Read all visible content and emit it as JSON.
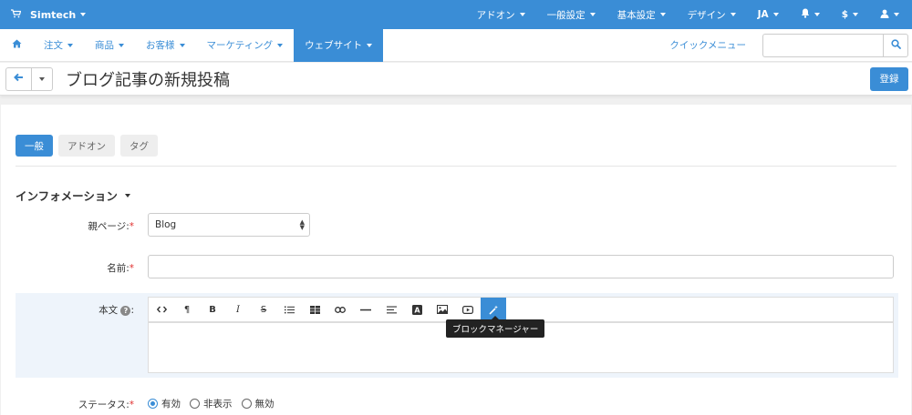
{
  "topbar": {
    "brand": "Simtech",
    "menus": [
      "アドオン",
      "一般設定",
      "基本設定",
      "デザイン",
      "JA",
      "$"
    ]
  },
  "nav": {
    "items": [
      "注文",
      "商品",
      "お客様",
      "マーケティング",
      "ウェブサイト"
    ],
    "active_index": 4,
    "quick_menu": "クイックメニュー",
    "search_placeholder": ""
  },
  "header": {
    "title": "ブログ記事の新規投稿",
    "save_label": "登録"
  },
  "tabs": [
    "一般",
    "アドオン",
    "タグ"
  ],
  "section": {
    "title": "インフォメーション"
  },
  "form": {
    "parent_label": "親ページ:",
    "parent_value": "Blog",
    "name_label": "名前:",
    "name_value": "",
    "body_label": "本文",
    "status_label": "ステータス:",
    "status_options": [
      "有効",
      "非表示",
      "無効"
    ],
    "status_selected": "有効"
  },
  "editor": {
    "tooltip": "ブロックマネージャー",
    "tools": [
      "code-view-icon",
      "paragraph-icon",
      "bold-icon",
      "italic-icon",
      "strikethrough-icon",
      "bullet-list-icon",
      "table-icon",
      "link-icon",
      "horizontal-rule-icon",
      "align-icon",
      "font-color-icon",
      "image-icon",
      "video-icon",
      "block-manager-icon"
    ],
    "active_tool": "block-manager-icon"
  },
  "colors": {
    "accent": "#3a8dd6",
    "required": "#e0302f"
  }
}
